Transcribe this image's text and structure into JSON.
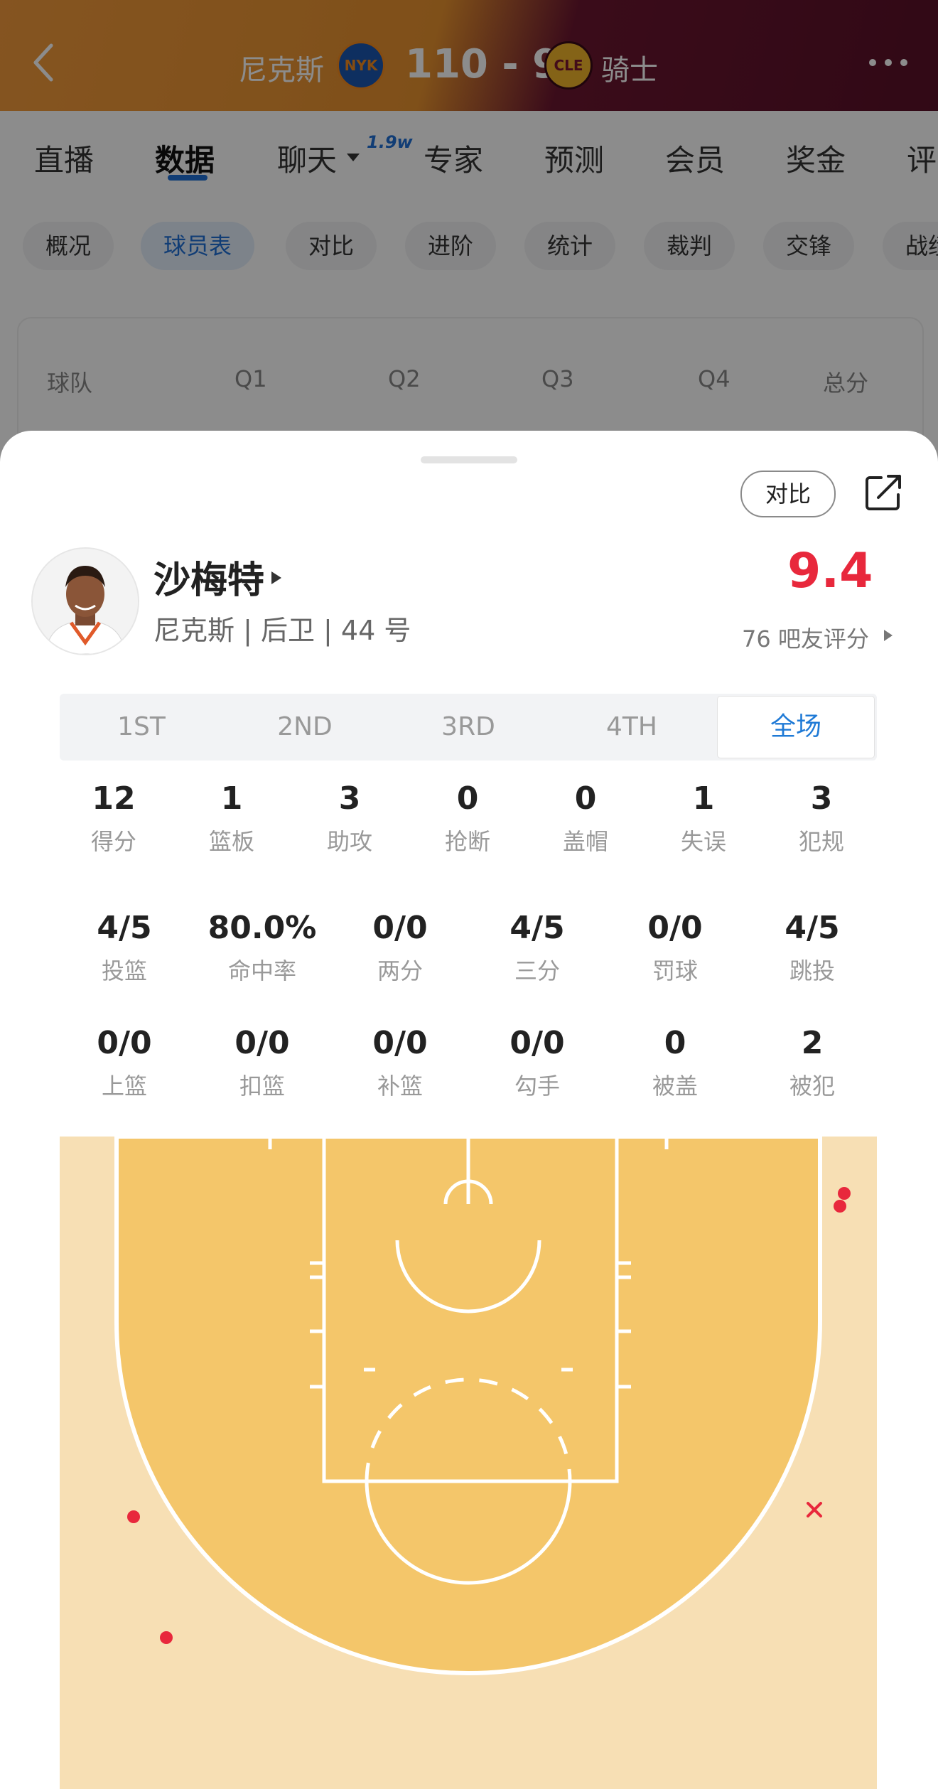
{
  "header": {
    "home_team": "尼克斯",
    "home_logo": "NYK",
    "score": "110 - 96",
    "away_logo": "CLE",
    "away_team": "骑士"
  },
  "tabs": [
    {
      "label": "直播"
    },
    {
      "label": "数据"
    },
    {
      "label": "聊天"
    },
    {
      "label": "专家"
    },
    {
      "label": "预测"
    },
    {
      "label": "会员"
    },
    {
      "label": "奖金"
    },
    {
      "label": "评"
    }
  ],
  "chat_badge": "1.9w",
  "subtabs": [
    {
      "label": "概况"
    },
    {
      "label": "球员表"
    },
    {
      "label": "对比"
    },
    {
      "label": "进阶"
    },
    {
      "label": "统计"
    },
    {
      "label": "裁判"
    },
    {
      "label": "交锋"
    },
    {
      "label": "战绩"
    }
  ],
  "score_table": {
    "headers": [
      "球队",
      "Q1",
      "Q2",
      "Q3",
      "Q4",
      "总分"
    ]
  },
  "sheet": {
    "compare_label": "对比",
    "player_name": "沙梅特",
    "player_meta": "尼克斯 | 后卫 | 44 号",
    "rating": "9.4",
    "rating_count": "76 吧友评分",
    "periods": [
      "1ST",
      "2ND",
      "3RD",
      "4TH",
      "全场"
    ],
    "active_period": "全场",
    "main_stats": [
      {
        "value": "12",
        "label": "得分"
      },
      {
        "value": "1",
        "label": "篮板"
      },
      {
        "value": "3",
        "label": "助攻"
      },
      {
        "value": "0",
        "label": "抢断"
      },
      {
        "value": "0",
        "label": "盖帽"
      },
      {
        "value": "1",
        "label": "失误"
      },
      {
        "value": "3",
        "label": "犯规"
      }
    ],
    "shooting_stats": [
      {
        "value": "4/5",
        "label": "投篮"
      },
      {
        "value": "80.0%",
        "label": "命中率"
      },
      {
        "value": "0/0",
        "label": "两分"
      },
      {
        "value": "4/5",
        "label": "三分"
      },
      {
        "value": "0/0",
        "label": "罚球"
      },
      {
        "value": "4/5",
        "label": "跳投"
      }
    ],
    "shot_type_stats": [
      {
        "value": "0/0",
        "label": "上篮"
      },
      {
        "value": "0/0",
        "label": "扣篮"
      },
      {
        "value": "0/0",
        "label": "补篮"
      },
      {
        "value": "0/0",
        "label": "勾手"
      },
      {
        "value": "0",
        "label": "被盖"
      },
      {
        "value": "2",
        "label": "被犯"
      }
    ]
  },
  "shot_chart": {
    "made_color": "#e8283c",
    "missed_color": "#e8283c",
    "court_fill": "#f4c66a",
    "out_fill": "#f7dfb4",
    "made": 4,
    "missed": 1
  }
}
